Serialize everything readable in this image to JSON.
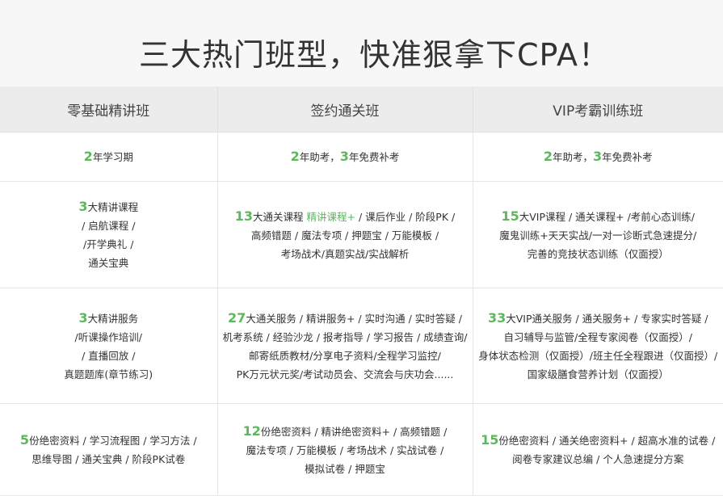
{
  "page_title": "三大热门班型，快准狠拿下CPA！",
  "colors": {
    "accent_green": "#5cb85c",
    "header_bg": "#ececec",
    "top_bg": "#f7f7f7"
  },
  "columns": [
    "零基础精讲班",
    "签约通关班",
    "VIP考霸训练班"
  ],
  "rows": [
    {
      "cells": [
        {
          "num": "2",
          "lines": [
            "年学习期"
          ]
        },
        {
          "num": "2",
          "lines": [
            "年助考，"
          ],
          "num2": "3",
          "tail": "年免费补考"
        },
        {
          "num": "2",
          "lines": [
            "年助考，"
          ],
          "num2": "3",
          "tail": "年免费补考"
        }
      ]
    },
    {
      "cells": [
        {
          "num": "3",
          "first": "大精讲课程",
          "lines": [
            "/ 启航课程 /",
            "/开学典礼 /",
            "通关宝典"
          ]
        },
        {
          "num": "13",
          "first": "大通关课程 ",
          "highlight": "精讲课程+",
          "first_tail": " / 课后作业 / 阶段PK /",
          "lines": [
            "高频错题 / 魔法专项 / 押题宝 / 万能模板 /",
            "考场战术/真题实战/实战解析"
          ]
        },
        {
          "num": "15",
          "first": "大VIP课程 / 通关课程+ /考前心态训练/",
          "lines": [
            "魔鬼训练+天天实战/一对一诊断式急速提分/",
            "完善的竞技状态训练（仅面授）"
          ]
        }
      ]
    },
    {
      "cells": [
        {
          "num": "3",
          "first": "大精讲服务",
          "lines": [
            "/听课操作培训/",
            "/ 直播回放 /",
            "真题题库(章节练习)"
          ]
        },
        {
          "num": "27",
          "first": "大通关服务 / 精讲服务+ / 实时沟通 / 实时答疑 /",
          "lines": [
            "机考系统 / 经验沙龙 / 报考指导 / 学习报告 / 成绩查询/",
            "邮寄纸质教材/分享电子资料/全程学习监控/",
            "PK万元状元奖/考试动员会、交流会与庆功会......"
          ]
        },
        {
          "num": "33",
          "first": "大VIP通关服务 / 通关服务+ / 专家实时答疑 /",
          "lines": [
            "自习辅导与监管/全程专家阅卷（仅面授）/",
            "身体状态检测（仅面授）/班主任全程跟进（仅面授）/",
            "国家级膳食营养计划（仅面授）"
          ]
        }
      ]
    },
    {
      "cells": [
        {
          "num": "5",
          "first": "份绝密资料 / 学习流程图 / 学习方法 /",
          "lines": [
            "思维导图 / 通关宝典 / 阶段PK试卷"
          ]
        },
        {
          "num": "12",
          "first": "份绝密资料 / 精讲绝密资料+ / 高频错题 /",
          "lines": [
            "魔法专项 / 万能模板 / 考场战术 / 实战试卷 /",
            "模拟试卷 / 押题宝"
          ]
        },
        {
          "num": "15",
          "first": "份绝密资料 / 通关绝密资料+ / 超高水准的试卷 /",
          "lines": [
            "阅卷专家建议总编 / 个人急速提分方案"
          ]
        }
      ]
    }
  ]
}
